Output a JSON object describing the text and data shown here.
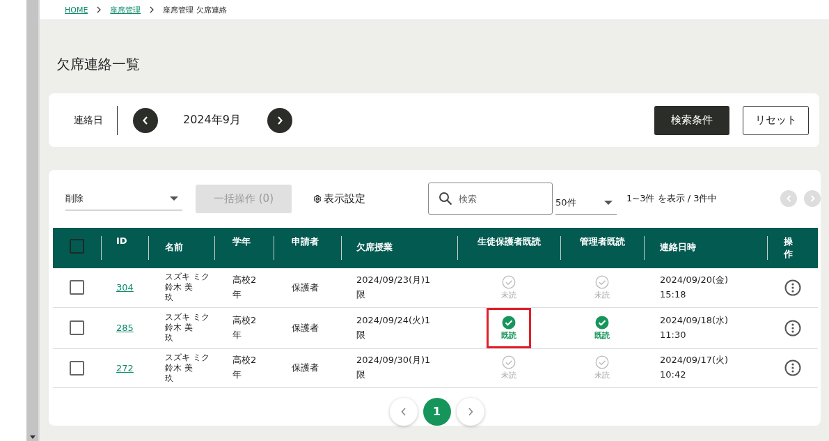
{
  "breadcrumb": [
    {
      "label": "HOME",
      "link": true
    },
    {
      "label": "座席管理",
      "link": true
    },
    {
      "label": "座席管理 欠席連絡",
      "link": false
    }
  ],
  "page_title": "欠席連絡一覧",
  "filter": {
    "label": "連絡日",
    "month": "2024年9月",
    "buttons": [
      {
        "label": "検索条件",
        "kind": "primary"
      },
      {
        "label": "リセット",
        "kind": "secondary"
      }
    ]
  },
  "toolbar": {
    "action_select": "削除",
    "bulk_button": {
      "label": "一括操作 (0)",
      "disabled": true
    },
    "display_settings": "表示設定",
    "search": {
      "placeholder": "検索"
    },
    "page_size": "50件",
    "range": "1~3件 を表示 / 3件中"
  },
  "table": {
    "header_checked": false,
    "columns": [
      "ID",
      "名前",
      "学年",
      "申請者",
      "欠席授業",
      "生徒保護者既読",
      "管理者既読",
      "連絡日時",
      "操作"
    ],
    "rows": [
      {
        "checked": false,
        "id": "304",
        "kana": "スズキ ミク",
        "name": "鈴木 美玖",
        "grade": "高校2年",
        "applicant": "保護者",
        "absence": "2024/09/23(月)1限",
        "guardian_read": {
          "label": "未読",
          "read": false,
          "highlighted": false
        },
        "admin_read": {
          "label": "未読",
          "read": false
        },
        "contacted": "2024/09/20(金) 15:18"
      },
      {
        "checked": false,
        "id": "285",
        "kana": "スズキ ミク",
        "name": "鈴木 美玖",
        "grade": "高校2年",
        "applicant": "保護者",
        "absence": "2024/09/24(火)1限",
        "guardian_read": {
          "label": "既読",
          "read": true,
          "highlighted": true
        },
        "admin_read": {
          "label": "既読",
          "read": true
        },
        "contacted": "2024/09/18(水) 11:30"
      },
      {
        "checked": false,
        "id": "272",
        "kana": "スズキ ミク",
        "name": "鈴木 美玖",
        "grade": "高校2年",
        "applicant": "保護者",
        "absence": "2024/09/30(月)1限",
        "guardian_read": {
          "label": "未読",
          "read": false,
          "highlighted": false
        },
        "admin_read": {
          "label": "未読",
          "read": false
        },
        "contacted": "2024/09/17(火) 10:42"
      }
    ]
  },
  "pagination": [
    {
      "label": "1",
      "selected": true
    }
  ]
}
